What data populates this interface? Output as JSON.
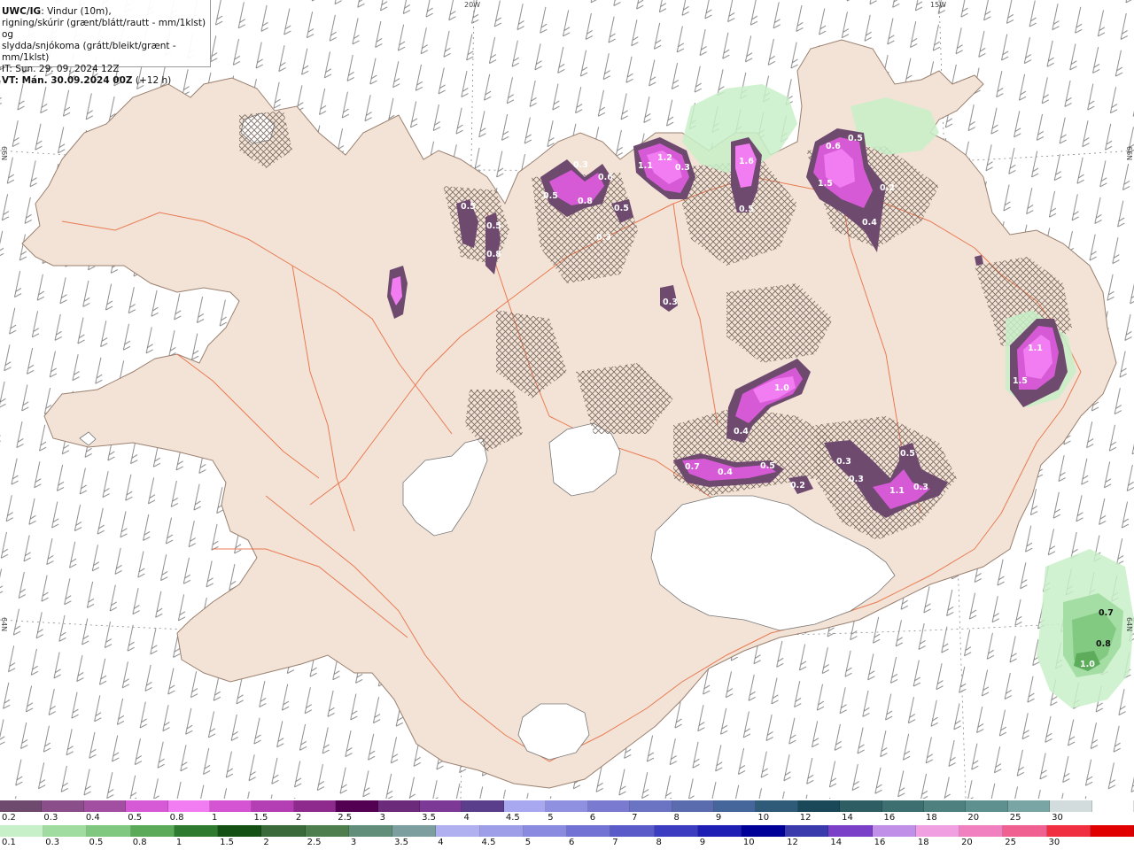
{
  "header": {
    "model": "UWC/IG",
    "line1": ": Vindur (10m),",
    "line2": "rigning/skúrir (grænt/blátt/rautt - mm/1klst) og",
    "line3": "slydda/snjókoma (grátt/bleikt/grænt - mm/1klst)",
    "issue_time": "IT: Sun. 29. 09. 2024 12Z",
    "valid_time": "VT: Mán. 30.09.2024 00Z",
    "lead_time": " (+12 h)"
  },
  "graticule": {
    "lon_labels": [
      "20W",
      "15W"
    ],
    "lat_labels_left": [
      "66N",
      "64N"
    ],
    "lat_labels_right": [
      "66N",
      "64N"
    ]
  },
  "precip_labels": [
    {
      "v": "0.5"
    },
    {
      "v": "0.3"
    },
    {
      "v": "0.5"
    },
    {
      "v": "0.8"
    },
    {
      "v": "0.6"
    },
    {
      "v": "0.5"
    },
    {
      "v": "1.1"
    },
    {
      "v": "1.2"
    },
    {
      "v": "0.3"
    },
    {
      "v": "1.6"
    },
    {
      "v": "0.5"
    },
    {
      "v": "0.6"
    },
    {
      "v": "0.5"
    },
    {
      "v": "1.5"
    },
    {
      "v": "0.2"
    },
    {
      "v": "0.4"
    },
    {
      "v": "0.5"
    },
    {
      "v": "0.8"
    },
    {
      "v": "0.3"
    },
    {
      "v": "0.3"
    },
    {
      "v": "1.0"
    },
    {
      "v": "0.4"
    },
    {
      "v": "0.7"
    },
    {
      "v": "0.4"
    },
    {
      "v": "0.5"
    },
    {
      "v": "0.2"
    },
    {
      "v": "0.3"
    },
    {
      "v": "0.5"
    },
    {
      "v": "0.3"
    },
    {
      "v": "1.1"
    },
    {
      "v": "0.3"
    },
    {
      "v": "1.1"
    },
    {
      "v": "1.5"
    }
  ],
  "rain_labels": [
    {
      "v": "0.7"
    },
    {
      "v": "0.8"
    },
    {
      "v": "1.0"
    }
  ],
  "legend_snow": {
    "labels": [
      "0.2",
      "0.3",
      "0.4",
      "0.5",
      "0.8",
      "1",
      "1.5",
      "2",
      "2.5",
      "3",
      "3.5",
      "4",
      "4.5",
      "5",
      "6",
      "7",
      "8",
      "9",
      "10",
      "12",
      "14",
      "16",
      "18",
      "20",
      "25",
      "30"
    ],
    "colors": [
      "#6e4a6e",
      "#8a4e8a",
      "#a24fa2",
      "#d65ad6",
      "#f27cf2",
      "#d454d4",
      "#b43eb4",
      "#8e2a8e",
      "#530053",
      "#6c2a7a",
      "#7c3a96",
      "#5a3e8c",
      "#a8a8f0",
      "#9090e0",
      "#7a7ad0",
      "#6a74c2",
      "#5a6cae",
      "#44669a",
      "#2f5a78",
      "#1a4858",
      "#2e5e64",
      "#3d6e70",
      "#4e8080",
      "#5e9090",
      "#7aa5a5",
      "#d2dcdc",
      "#ffffff"
    ]
  },
  "legend_rain": {
    "labels": [
      "0.1",
      "0.3",
      "0.5",
      "0.8",
      "1",
      "1.5",
      "2",
      "2.5",
      "3",
      "3.5",
      "4",
      "4.5",
      "5",
      "6",
      "7",
      "8",
      "9",
      "10",
      "12",
      "14",
      "16",
      "18",
      "20",
      "25",
      "30"
    ],
    "colors": [
      "#c8f0c8",
      "#a0dca0",
      "#80c880",
      "#5aaa5a",
      "#2e7a2e",
      "#145014",
      "#3a6a3a",
      "#4e7e4e",
      "#608e7a",
      "#7c9e9e",
      "#b0b0f0",
      "#9e9ee8",
      "#8a8ae0",
      "#7272d4",
      "#5a5ac8",
      "#3c3cc0",
      "#1e1eb4",
      "#000098",
      "#3a3aac",
      "#7a40c8",
      "#c090e8",
      "#f0a0e0",
      "#f080c0",
      "#f06090",
      "#f03040",
      "#e00000"
    ]
  }
}
